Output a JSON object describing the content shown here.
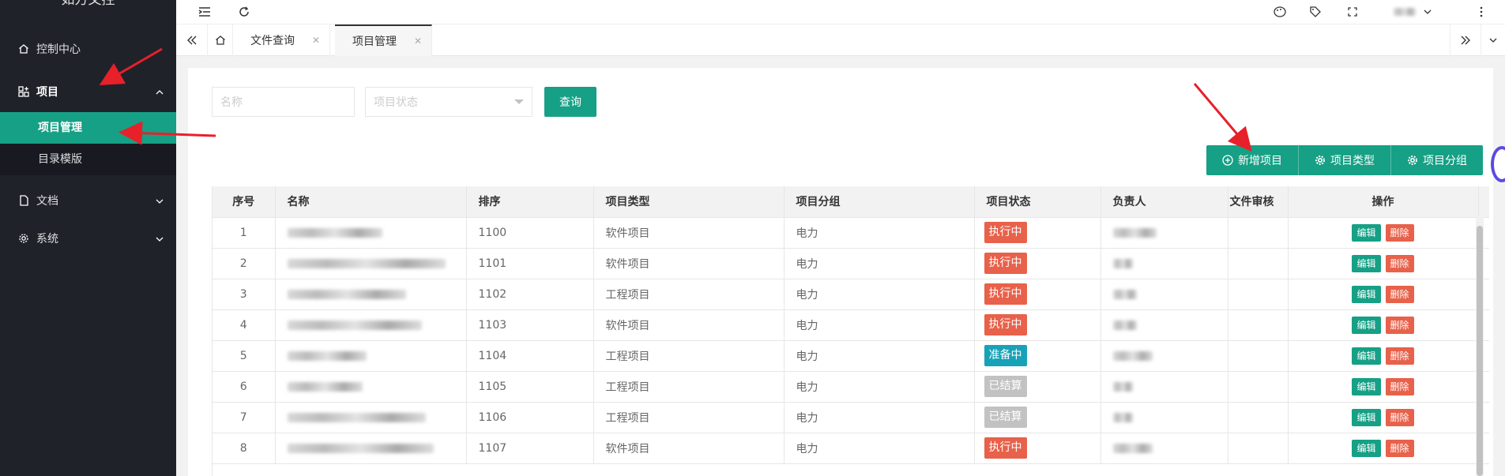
{
  "app": {
    "title": "如方文控"
  },
  "sidebar": {
    "items": [
      {
        "label": "控制中心",
        "icon": "home-icon"
      },
      {
        "label": "项目",
        "icon": "apps-icon",
        "expanded": true,
        "children": [
          {
            "label": "项目管理",
            "active": true
          },
          {
            "label": "目录模版"
          }
        ]
      },
      {
        "label": "文档",
        "icon": "file-icon"
      },
      {
        "label": "系统",
        "icon": "gear-icon"
      }
    ]
  },
  "tabs": [
    {
      "label": "文件查询",
      "closable": true
    },
    {
      "label": "项目管理",
      "closable": true,
      "active": true
    }
  ],
  "search": {
    "name_placeholder": "名称",
    "status_placeholder": "项目状态",
    "query_label": "查询"
  },
  "toolbar": {
    "add_label": "新增项目",
    "type_label": "项目类型",
    "group_label": "项目分组"
  },
  "table": {
    "columns": [
      "序号",
      "名称",
      "排序",
      "项目类型",
      "项目分组",
      "项目状态",
      "负责人",
      "文件审核",
      "操作"
    ],
    "edit_label": "编辑",
    "delete_label": "删除",
    "rows": [
      {
        "no": "1",
        "sort": "1100",
        "type": "软件项目",
        "group": "电力",
        "status": "执行中"
      },
      {
        "no": "2",
        "sort": "1101",
        "type": "软件项目",
        "group": "电力",
        "status": "执行中"
      },
      {
        "no": "3",
        "sort": "1102",
        "type": "工程项目",
        "group": "电力",
        "status": "执行中"
      },
      {
        "no": "4",
        "sort": "1103",
        "type": "软件项目",
        "group": "电力",
        "status": "执行中"
      },
      {
        "no": "5",
        "sort": "1104",
        "type": "工程项目",
        "group": "电力",
        "status": "准备中"
      },
      {
        "no": "6",
        "sort": "1105",
        "type": "工程项目",
        "group": "电力",
        "status": "已结算"
      },
      {
        "no": "7",
        "sort": "1106",
        "type": "工程项目",
        "group": "电力",
        "status": "已结算"
      },
      {
        "no": "8",
        "sort": "1107",
        "type": "软件项目",
        "group": "电力",
        "status": "执行中"
      }
    ]
  },
  "colors": {
    "accent": "#16a085",
    "danger": "#e8614a",
    "info": "#17a2b8",
    "muted": "#c2c2c2",
    "sidebar": "#20222a"
  }
}
